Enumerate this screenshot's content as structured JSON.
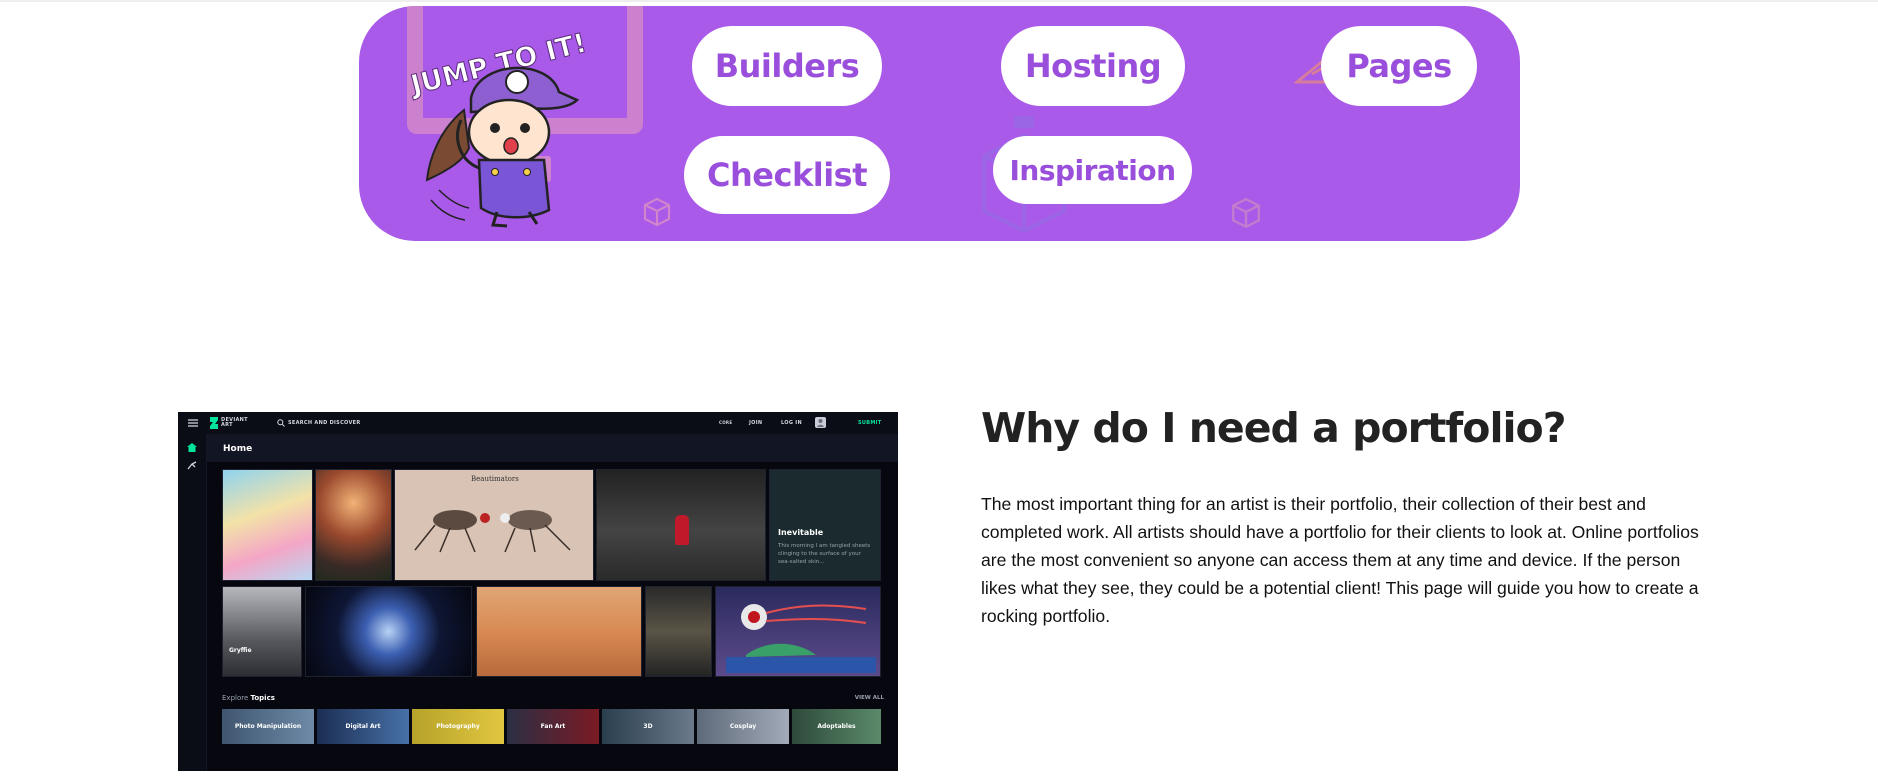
{
  "jump_banner": {
    "mascot_text": "JUMP TO IT!",
    "links": {
      "builders": "Builders",
      "hosting": "Hosting",
      "pages": "Pages",
      "checklist": "Checklist",
      "inspiration": "Inspiration"
    },
    "colors": {
      "banner": "#a95ae8",
      "pill_text": "#9a4fdc",
      "deco": "#d085cd"
    }
  },
  "screenshot": {
    "logo": "DEVIANT ART",
    "search_placeholder": "SEARCH AND DISCOVER",
    "nav": {
      "core": "CORE",
      "join": "JOIN",
      "login": "LOG IN",
      "submit": "SUBMIT"
    },
    "home_label": "Home",
    "tiles": {
      "beautimators": "Beautimators",
      "inevitable_title": "Inevitable",
      "inevitable_text": "This morning I am tangled sheets clinging to the surface of your sea-salted skin...",
      "gryffie": "Gryffie"
    },
    "explore_prefix": "Explore",
    "explore_topics": "Topics",
    "view_all": "VIEW ALL",
    "topics": [
      "Photo Manipulation",
      "Digital Art",
      "Photography",
      "Fan Art",
      "3D",
      "Cosplay",
      "Adoptables"
    ]
  },
  "section": {
    "title": "Why do I need a portfolio?",
    "body": "The most important thing for an artist is their portfolio, their collection of their best and completed work. All artists should have a portfolio for their clients to look at. Online portfolios are the most convenient so anyone can access them at any time and device. If the person likes what they see, they could be a potential client! This page will guide you how to create a rocking portfolio."
  }
}
